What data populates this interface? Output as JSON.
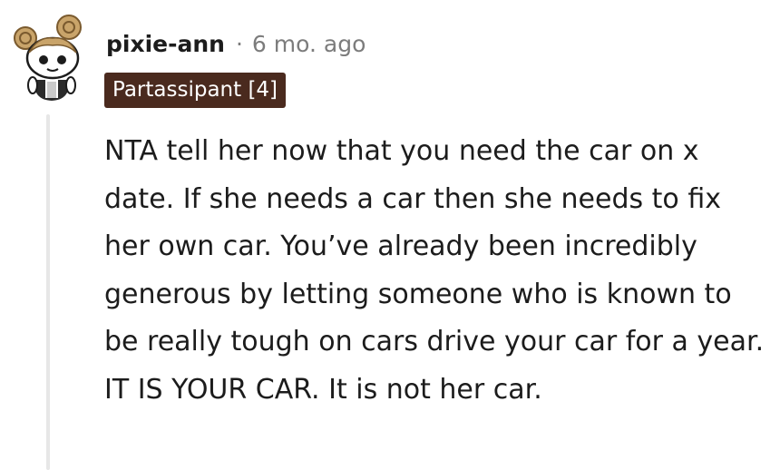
{
  "comment": {
    "author": "pixie-ann",
    "separator": "·",
    "timestamp": "6 mo. ago",
    "flair": "Partassipant [4]",
    "body": "NTA tell her now that you need the car on x date. If she needs a car then she needs to fix her own car. You’ve already been incredibly generous by letting someone who is known to be really tough on cars drive your car for a year. IT IS YOUR CAR. It is not her car."
  },
  "colors": {
    "flair_background": "#4a2a1e",
    "text": "#1c1c1c",
    "meta": "#7c7c7c",
    "thread_line": "#e7e7e7"
  },
  "icons": {
    "avatar": "snoo-avatar-icon"
  }
}
